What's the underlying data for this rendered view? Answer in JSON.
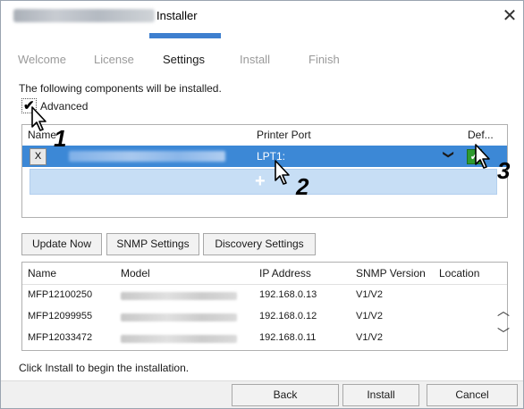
{
  "window": {
    "title": "Installer",
    "close_glyph": "✕"
  },
  "steps": [
    {
      "label": "Welcome",
      "active": false
    },
    {
      "label": "License",
      "active": false
    },
    {
      "label": "Settings",
      "active": true
    },
    {
      "label": "Install",
      "active": false
    },
    {
      "label": "Finish",
      "active": false
    }
  ],
  "description": "The following components will be installed.",
  "advanced": {
    "label": "Advanced",
    "checked": true
  },
  "components": {
    "headers": {
      "name": "Name",
      "port": "Printer Port",
      "default": "Def..."
    },
    "rows": [
      {
        "remove": "X",
        "port": "LPT1:",
        "default_checked": true
      }
    ],
    "add_glyph": "+"
  },
  "buttons": {
    "update_now": "Update Now",
    "snmp_settings": "SNMP Settings",
    "discovery_settings": "Discovery Settings"
  },
  "devices": {
    "headers": {
      "name": "Name",
      "model": "Model",
      "ip": "IP Address",
      "snmp": "SNMP Version",
      "location": "Location"
    },
    "rows": [
      {
        "name": "MFP12100250",
        "ip": "192.168.0.13",
        "snmp": "V1/V2"
      },
      {
        "name": "MFP12099955",
        "ip": "192.168.0.12",
        "snmp": "V1/V2"
      },
      {
        "name": "MFP12033472",
        "ip": "192.168.0.11",
        "snmp": "V1/V2"
      }
    ]
  },
  "status": "Click Install to begin the installation.",
  "footer": {
    "back": "Back",
    "install": "Install",
    "cancel": "Cancel"
  },
  "callouts": [
    "1",
    "2",
    "3"
  ],
  "colors": {
    "accent": "#3e7fcf",
    "row_selected": "#3c88d6",
    "add_row": "#c7def5",
    "check_green": "#2f9b2f"
  }
}
